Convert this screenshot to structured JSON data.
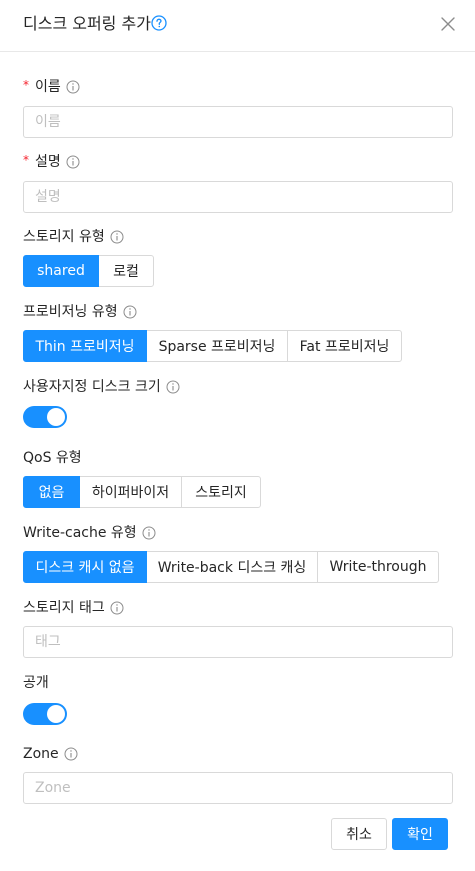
{
  "dialog": {
    "title": "디스크 오퍼링 추가",
    "accent_color": "#1890ff",
    "required_color": "#f5222d"
  },
  "fields": {
    "name": {
      "label": "이름",
      "placeholder": "이름",
      "required": true
    },
    "description": {
      "label": "설명",
      "placeholder": "설명",
      "required": true
    },
    "storage_type": {
      "label": "스토리지 유형",
      "options": [
        "shared",
        "로컬"
      ],
      "selected": "shared"
    },
    "provisioning_type": {
      "label": "프로비저닝 유형",
      "options": [
        "Thin 프로비저닝",
        "Sparse 프로비저닝",
        "Fat 프로비저닝"
      ],
      "selected": "Thin 프로비저닝"
    },
    "custom_disk_size": {
      "label": "사용자지정 디스크 크기",
      "enabled": true
    },
    "qos_type": {
      "label": "QoS 유형",
      "options": [
        "없음",
        "하이퍼바이저",
        "스토리지"
      ],
      "selected": "없음"
    },
    "write_cache_type": {
      "label": "Write-cache 유형",
      "options": [
        "디스크 캐시 없음",
        "Write-back 디스크 캐싱",
        "Write-through"
      ],
      "selected": "디스크 캐시 없음"
    },
    "storage_tags": {
      "label": "스토리지 태그",
      "placeholder": "태그"
    },
    "public": {
      "label": "공개",
      "enabled": true
    },
    "zone": {
      "label": "Zone",
      "placeholder": "Zone"
    }
  },
  "footer": {
    "cancel_label": "취소",
    "ok_label": "확인"
  }
}
